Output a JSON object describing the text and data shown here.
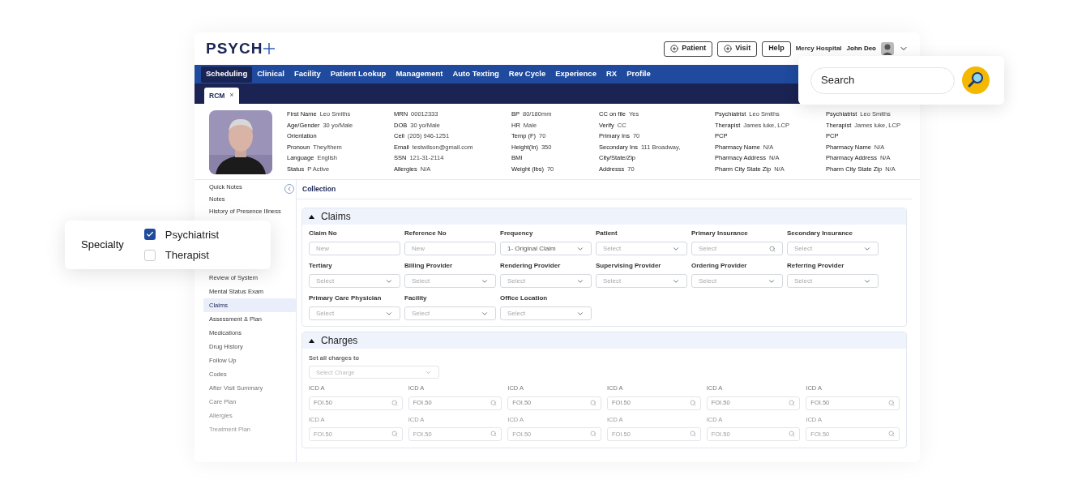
{
  "header": {
    "logo": "PSYCH",
    "buttons": [
      {
        "label": "Patient",
        "kind": "add"
      },
      {
        "label": "Visit",
        "kind": "add"
      },
      {
        "label": "Help",
        "kind": "plain"
      }
    ],
    "facility": "Mercy Hospital",
    "user": "John Deo"
  },
  "nav": [
    {
      "label": "Scheduling",
      "selected": true
    },
    {
      "label": "Clinical",
      "selected": false
    },
    {
      "label": "Facility",
      "selected": false
    },
    {
      "label": "Patient Lookup",
      "selected": false
    },
    {
      "label": "Management",
      "selected": false
    },
    {
      "label": "Auto Texting",
      "selected": false
    },
    {
      "label": "Rev Cycle",
      "selected": false
    },
    {
      "label": "Experience",
      "selected": false
    },
    {
      "label": "RX",
      "selected": false
    },
    {
      "label": "Profile",
      "selected": false
    }
  ],
  "open_tabs": [
    {
      "label": "RCM",
      "close": "×"
    }
  ],
  "patient_info": [
    [
      {
        "label": "First Name",
        "value": "Leo Smiths"
      },
      {
        "label": "Age/Gender",
        "value": "30 yo/Male"
      },
      {
        "label": "Orientation"
      },
      {
        "label": "Pronoun",
        "value": "They/them"
      },
      {
        "label": "Language",
        "value": "English"
      },
      {
        "label": "Status",
        "value": "P Active"
      }
    ],
    [
      {
        "label": "MRN",
        "value": "00012333"
      },
      {
        "label": "DOB",
        "value": "30 yo/Male"
      },
      {
        "label": "Cell",
        "value": "(205) 946-1251"
      },
      {
        "label": "Email",
        "value": "testwilson@gmail.com"
      },
      {
        "label": "SSN",
        "value": "121-31-2114"
      },
      {
        "label": "Allergies",
        "value": "N/A"
      }
    ],
    [
      {
        "label": "BP",
        "value": "80/180mm"
      },
      {
        "label": "HR",
        "value": "Male"
      },
      {
        "label": "Temp (F)",
        "value": "70"
      },
      {
        "label": "Height(In)",
        "value": "350"
      },
      {
        "label": "BMI"
      },
      {
        "label": "Weight (lbs)",
        "value": "70"
      }
    ],
    [
      {
        "label": "CC on file",
        "value": "Yes"
      },
      {
        "label": "Verify",
        "value": "CC"
      },
      {
        "label": "Primary Ins",
        "value": "70"
      },
      {
        "label": "Secondary Ins",
        "value": "111 Broadway,"
      },
      {
        "label": "City/State/Zip"
      },
      {
        "label": "Addresss",
        "value": "70"
      }
    ],
    [
      {
        "label": "Psychiatrist",
        "value": "Leo Smiths"
      },
      {
        "label": "Therapist",
        "value": "James luke, LCP"
      },
      {
        "label": "PCP"
      },
      {
        "label": "Pharmacy Name",
        "value": "N/A"
      },
      {
        "label": "Pharmacy Address",
        "value": "N/A"
      },
      {
        "label": "Pharm City State Zip",
        "value": "N/A"
      }
    ],
    [
      {
        "label": "Psychiatrist",
        "value": "Leo Smiths"
      },
      {
        "label": "Therapist",
        "value": "James luke, LCP"
      },
      {
        "label": "PCP"
      },
      {
        "label": "Pharmacy Name",
        "value": "N/A"
      },
      {
        "label": "Pharmacy Address",
        "value": "N/A"
      },
      {
        "label": "Pharm City State Zip",
        "value": "N/A"
      }
    ]
  ],
  "sidebar": {
    "top": [
      {
        "label": "Quick Notes",
        "selected": false
      },
      {
        "label": "Notes",
        "selected": false
      },
      {
        "label": "History of Presence Illness",
        "selected": false
      }
    ],
    "bottom": [
      {
        "label": "Review of System",
        "selected": false
      },
      {
        "label": "Mental Status Exam",
        "selected": false
      },
      {
        "label": "Claims",
        "selected": true
      },
      {
        "label": "Assessment & Plan",
        "selected": false
      },
      {
        "label": "Medications",
        "selected": false
      },
      {
        "label": "Drug History",
        "selected": false
      },
      {
        "label": "Follow Up",
        "selected": false
      },
      {
        "label": "Codes",
        "selected": false
      },
      {
        "label": "After Visit Summary",
        "selected": false
      },
      {
        "label": "Care Plan",
        "selected": false
      },
      {
        "label": "Allergies",
        "selected": false
      },
      {
        "label": "Treatment Plan",
        "selected": false
      }
    ]
  },
  "content_title": "Collection",
  "claims": {
    "title": "Claims",
    "expanded": true,
    "fields": [
      {
        "label": "Claim No",
        "kind": "text",
        "placeholder": "New"
      },
      {
        "label": "Reference No",
        "kind": "text",
        "placeholder": "New"
      },
      {
        "label": "Frequency",
        "kind": "select",
        "value": "1- Original Claim"
      },
      {
        "label": "Patient",
        "kind": "select",
        "placeholder": "Select"
      },
      {
        "label": "Primary Insurance",
        "kind": "search",
        "placeholder": "Select"
      },
      {
        "label": "Secondary Insurance",
        "kind": "select",
        "placeholder": "Select"
      },
      {
        "label": "Tertiary",
        "kind": "select",
        "placeholder": "Select"
      },
      {
        "label": "Billing Provider",
        "kind": "select",
        "placeholder": "Select"
      },
      {
        "label": "Rendering Provider",
        "kind": "select",
        "placeholder": "Select"
      },
      {
        "label": "Supervising Provider",
        "kind": "select",
        "placeholder": "Select"
      },
      {
        "label": "Ordering Provider",
        "kind": "select",
        "placeholder": "Select"
      },
      {
        "label": "Referring Provider",
        "kind": "select",
        "placeholder": "Select"
      },
      {
        "label": "Primary Care Physician",
        "kind": "select",
        "placeholder": "Select"
      },
      {
        "label": "Facility",
        "kind": "select",
        "placeholder": "Select"
      },
      {
        "label": "Office Location",
        "kind": "select",
        "placeholder": "Select"
      }
    ]
  },
  "charges": {
    "title": "Charges",
    "expanded": true,
    "set_all_label": "Set all charges to",
    "set_all_placeholder": "Select Charge",
    "icd_rows": [
      [
        {
          "label": "ICD A",
          "placeholder": "FOI.50"
        },
        {
          "label": "ICD A",
          "placeholder": "FOI.50"
        },
        {
          "label": "ICD A",
          "placeholder": "FOI.50"
        },
        {
          "label": "ICD A",
          "placeholder": "FOI.50"
        },
        {
          "label": "ICD A",
          "placeholder": "FOI.50"
        },
        {
          "label": "ICD A",
          "placeholder": "FOI.50"
        }
      ],
      [
        {
          "label": "ICD A",
          "placeholder": "FOI.50"
        },
        {
          "label": "ICD A",
          "placeholder": "FOI.50"
        },
        {
          "label": "ICD A",
          "placeholder": "FOI.50"
        },
        {
          "label": "ICD A",
          "placeholder": "FOI.50"
        },
        {
          "label": "ICD A",
          "placeholder": "FOI.50"
        },
        {
          "label": "ICD A",
          "placeholder": "FOI.50"
        }
      ]
    ]
  },
  "search_card": {
    "placeholder": "Search"
  },
  "specialty_card": {
    "label": "Specialty",
    "options": [
      {
        "label": "Psychiatrist",
        "checked": true
      },
      {
        "label": "Therapist",
        "checked": false
      }
    ]
  }
}
